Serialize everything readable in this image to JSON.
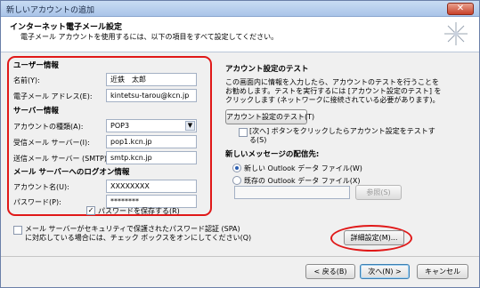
{
  "window": {
    "title": "新しいアカウントの追加",
    "close_symbol": "✕"
  },
  "header": {
    "title": "インターネット電子メール設定",
    "subtitle": "電子メール アカウントを使用するには、以下の項目をすべて設定してください。",
    "icon": "sparkle-icon"
  },
  "user_info": {
    "heading": "ユーザー情報",
    "name_label": "名前(Y):",
    "name_value": "近鉄　太郎",
    "email_label": "電子メール アドレス(E):",
    "email_value": "kintetsu-tarou@kcn.jp"
  },
  "server_info": {
    "heading": "サーバー情報",
    "account_type_label": "アカウントの種類(A):",
    "account_type_value": "POP3",
    "incoming_label": "受信メール サーバー(I):",
    "incoming_value": "pop1.kcn.jp",
    "outgoing_label": "送信メール サーバー (SMTP)(O):",
    "outgoing_value": "smtp.kcn.jp"
  },
  "logon_info": {
    "heading": "メール サーバーへのログオン情報",
    "account_name_label": "アカウント名(U):",
    "account_name_value": "XXXXXXXX",
    "password_label": "パスワード(P):",
    "password_value": "********",
    "remember_label": "パスワードを保存する(R)",
    "remember_checked": true
  },
  "spa": {
    "line1": "メール サーバーがセキュリティで保護されたパスワード認証 (SPA)",
    "line2": "に対応している場合には、チェック ボックスをオンにしてください(Q)",
    "checked": false
  },
  "test_settings": {
    "heading": "アカウント設定のテスト",
    "desc_line1": "この画面内に情報を入力したら、アカウントのテストを行うことを",
    "desc_line2": "お勧めします。テストを実行するには [アカウント設定のテスト] を",
    "desc_line3": "クリックします (ネットワークに接続されている必要があります)。",
    "test_button": "アカウント設定のテスト(T)",
    "auto_test_line1": "[次へ] ボタンをクリックしたらアカウント設定をテストす",
    "auto_test_line2": "る(S)",
    "auto_test_checked": false
  },
  "delivery": {
    "heading": "新しいメッセージの配信先:",
    "option_new": "新しい Outlook データ ファイル(W)",
    "option_existing": "既存の Outlook データ ファイル(X)",
    "selected": "new",
    "path_value": "",
    "browse_button": "参照(S)"
  },
  "more_settings_button": "詳細設定(M)...",
  "nav": {
    "back": "< 戻る(B)",
    "next": "次へ(N) >",
    "cancel": "キャンセル"
  },
  "colors": {
    "highlight": "#e01818",
    "titlebar": "#a9c4e8"
  }
}
